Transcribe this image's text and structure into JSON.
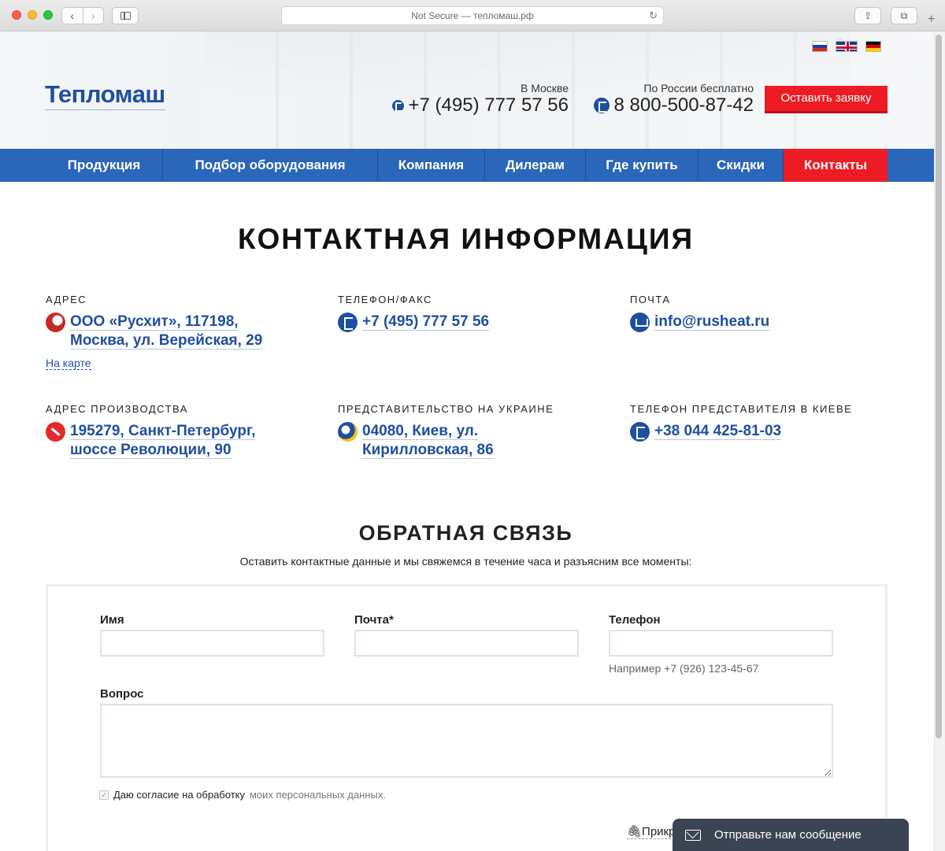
{
  "browser": {
    "url_text": "Not Secure — тепломаш.рф",
    "reload": "↻",
    "back": "‹",
    "forward": "›",
    "share": "⇪",
    "tabs": "⧉",
    "new_tab": "+"
  },
  "header": {
    "logo": "Тепломаш",
    "moscow_caption": "В Москве",
    "moscow_phone": "+7 (495) 777 57 56",
    "russia_caption": "По России бесплатно",
    "russia_phone": "8 800-500-87-42",
    "cta": "Оставить заявку",
    "languages": [
      "ru",
      "en",
      "de"
    ]
  },
  "nav": {
    "items": [
      "Продукция",
      "Подбор оборудования",
      "Компания",
      "Дилерам",
      "Где купить",
      "Скидки",
      "Контакты"
    ],
    "active": "Контакты"
  },
  "page_title": "КОНТАКТНАЯ ИНФОРМАЦИЯ",
  "contacts": {
    "address": {
      "label": "АДРЕС",
      "line1": "ООО «Русхит», 117198,",
      "line2": "Москва, ул. Верейская, 29",
      "map_link": "На карте"
    },
    "phone_fax": {
      "label": "ТЕЛЕФОН/ФАКС",
      "value": "+7 (495) 777 57 56"
    },
    "mail": {
      "label": "ПОЧТА",
      "value": "info@rusheat.ru"
    },
    "production": {
      "label": "АДРЕС ПРОИЗВОДСТВА",
      "line1": "195279, Санкт-Петербург,",
      "line2": "шоссе Революции, 90"
    },
    "ukraine": {
      "label": "ПРЕДСТАВИТЕЛЬСТВО НА УКРАИНЕ",
      "line1": "04080, Киев, ул.",
      "line2": "Кирилловская, 86"
    },
    "kiev_phone": {
      "label": "ТЕЛЕФОН ПРЕДСТАВИТЕЛЯ В КИЕВЕ",
      "value": "+38 044 425-81-03"
    }
  },
  "feedback": {
    "title": "ОБРАТНАЯ СВЯЗЬ",
    "subtitle": "Оставить контактные данные и мы свяжемся в течение часа и разъясним все моменты:",
    "name_label": "Имя",
    "email_label": "Почта*",
    "phone_label": "Телефон",
    "phone_hint": "Например +7 (926) 123-45-67",
    "question_label": "Вопрос",
    "consent_prefix": "Даю согласие на обработку",
    "consent_suffix": "моих персональных данных.",
    "consent_checked": true,
    "attach": "Прикр"
  },
  "chat": {
    "label": "Отправьте нам сообщение"
  },
  "colors": {
    "brand_blue": "#2a66b9",
    "accent_red": "#ed1c24",
    "link_blue": "#1f4fa0"
  }
}
